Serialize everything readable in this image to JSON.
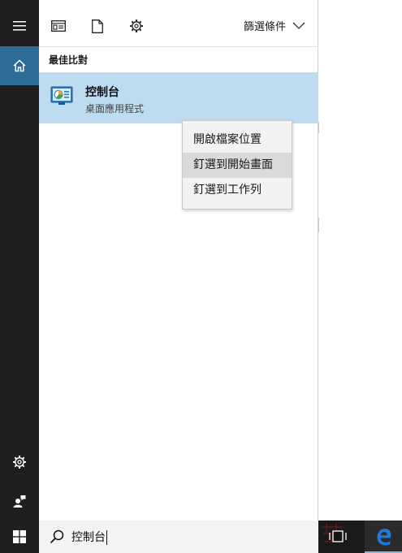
{
  "toolbar": {
    "filter_label": "篩選條件",
    "icons": [
      "apps-icon",
      "document-icon",
      "settings-icon"
    ]
  },
  "results": {
    "section_title": "最佳比對",
    "best_match": {
      "title": "控制台",
      "subtitle": "桌面應用程式",
      "icon": "control-panel-icon"
    }
  },
  "context_menu": {
    "items": [
      {
        "label": "開啟檔案位置"
      },
      {
        "label": "釘選到開始畫面"
      },
      {
        "label": "釘選到工作列"
      }
    ],
    "hovered_index": 1
  },
  "search": {
    "query": "控制台"
  },
  "rail": {
    "icons": [
      "hamburger-icon",
      "home-icon",
      "gear-icon",
      "user-feedback-icon"
    ]
  },
  "colors": {
    "rail": "#1f1f1f",
    "rail_active": "#2e6c98",
    "selected_item": "#bedcf0",
    "taskbar": "#151515",
    "edge_blue": "#1e7ad6"
  }
}
